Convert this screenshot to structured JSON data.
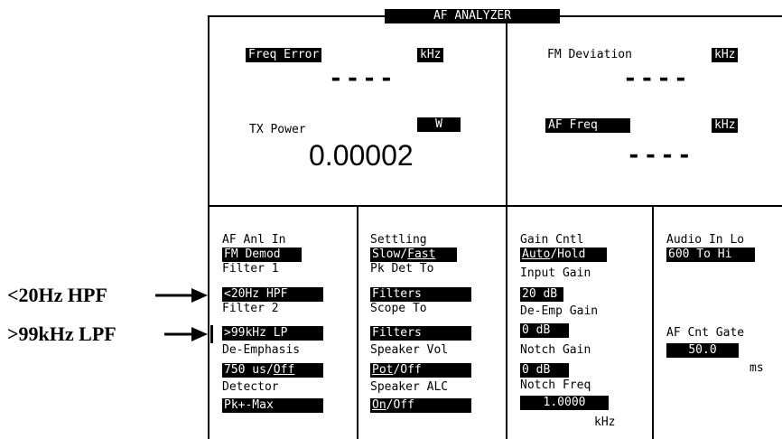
{
  "screen": {
    "title": "AF ANALYZER"
  },
  "meters": {
    "freq_error": {
      "label": "Freq Error",
      "unit": "kHz",
      "value": "----"
    },
    "fm_deviation": {
      "label": "FM Deviation",
      "unit": "kHz",
      "value": "----"
    },
    "tx_power": {
      "label": "TX Power",
      "unit": "W",
      "value": "0.00002"
    },
    "af_freq": {
      "label": "AF Freq",
      "unit": "kHz",
      "value": "----"
    }
  },
  "callouts": {
    "hpf": "<20Hz HPF",
    "lpf": ">99kHz LPF"
  },
  "fields": {
    "col1": {
      "af_anl_in": {
        "label": "AF Anl In",
        "value": "FM Demod"
      },
      "filter1": {
        "label": "Filter 1",
        "value": "<20Hz HPF"
      },
      "filter2": {
        "label": "Filter 2",
        "value": ">99kHz LP"
      },
      "de_emphasis": {
        "label": "De-Emphasis",
        "value_a": "750 us/",
        "value_b": "Off"
      },
      "detector": {
        "label": "Detector",
        "value": "Pk+-Max"
      }
    },
    "col2": {
      "settling": {
        "label": "Settling",
        "value_a": "Slow/",
        "value_b": "Fast"
      },
      "pk_det_to": {
        "label": "Pk Det To",
        "value": "Filters"
      },
      "scope_to": {
        "label": "Scope To",
        "value": "Filters"
      },
      "speaker_vol": {
        "label": "Speaker Vol",
        "value_a": "Pot",
        "value_b": "/Off"
      },
      "speaker_alc": {
        "label": "Speaker ALC",
        "value_a": "On",
        "value_b": "/Off"
      }
    },
    "col3": {
      "gain_cntl": {
        "label": "Gain Cntl",
        "value_a": "Auto",
        "value_b": "/Hold"
      },
      "input_gain": {
        "label": "Input Gain",
        "value": "20 dB"
      },
      "de_emp_gain": {
        "label": "De-Emp Gain",
        "value": "0 dB"
      },
      "notch_gain": {
        "label": "Notch Gain",
        "value": "0 dB"
      },
      "notch_freq": {
        "label": "Notch Freq",
        "value": "1.0000",
        "unit": "kHz"
      }
    },
    "col4": {
      "audio_in_lo": {
        "label": "Audio In Lo",
        "value": "600 To Hi"
      },
      "af_cnt_gate": {
        "label": "AF Cnt Gate",
        "value": "50.0",
        "unit": "ms"
      }
    }
  }
}
